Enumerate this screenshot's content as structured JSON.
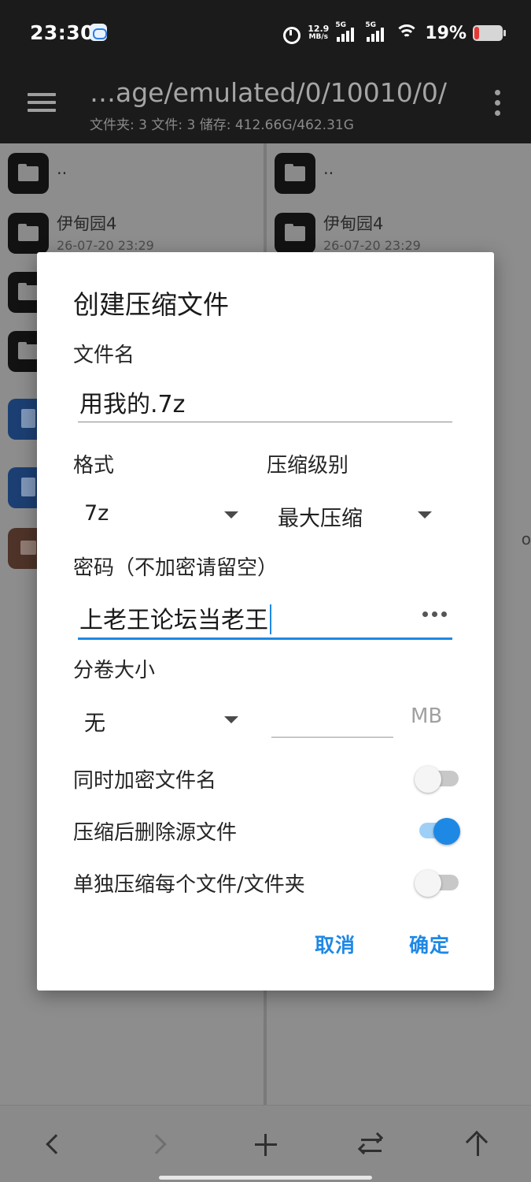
{
  "status_bar": {
    "time": "23:30",
    "net_speed_value": "12.9",
    "net_speed_unit": "MB/s",
    "sim1_label": "5G",
    "sim2_label": "5G",
    "battery_percent": "19%",
    "battery_color": "#e53935"
  },
  "toolbar": {
    "path": "…age/emulated/0/10010/0/",
    "info": "文件夹: 3  文件: 3  储存: 412.66G/462.31G"
  },
  "left_pane": {
    "items": [
      {
        "name": "..",
        "date": ""
      },
      {
        "name": "伊甸园4",
        "date": "26-07-20 23:29"
      }
    ]
  },
  "right_pane": {
    "items": [
      {
        "name": "..",
        "date": ""
      },
      {
        "name": "伊甸园4",
        "date": "26-07-20 23:29"
      }
    ],
    "edge_text": "o"
  },
  "dialog": {
    "title": "创建压缩文件",
    "filename_label": "文件名",
    "filename_value": "用我的.7z",
    "format_label": "格式",
    "format_value": "7z",
    "level_label": "压缩级别",
    "level_value": "最大压缩",
    "password_label": "密码（不加密请留空）",
    "password_value": "上老王论坛当老王",
    "volume_label": "分卷大小",
    "volume_value": "无",
    "volume_unit": "MB",
    "encrypt_names_label": "同时加密文件名",
    "encrypt_names_on": false,
    "delete_source_label": "压缩后删除源文件",
    "delete_source_on": true,
    "separate_label": "单独压缩每个文件/文件夹",
    "separate_on": false,
    "cancel_label": "取消",
    "ok_label": "确定",
    "accent_color": "#1e88e5"
  }
}
